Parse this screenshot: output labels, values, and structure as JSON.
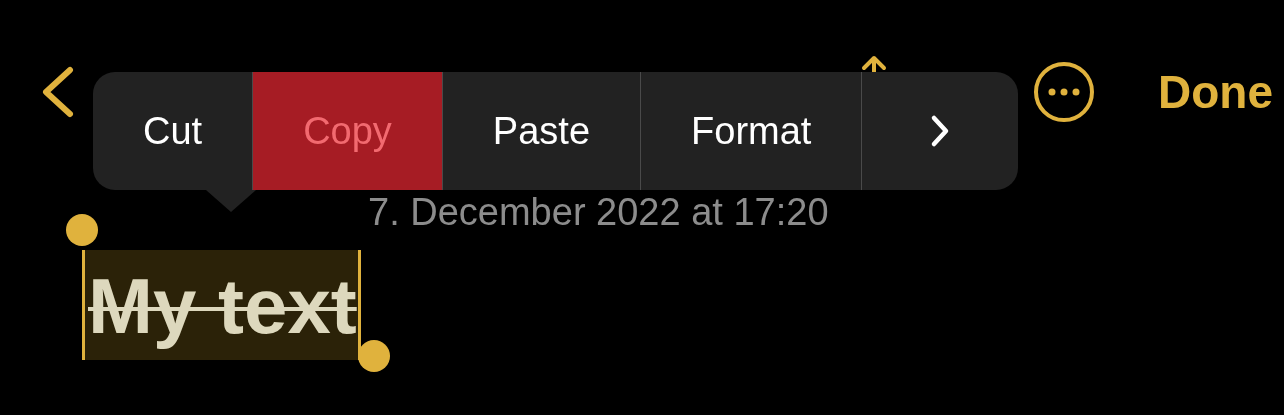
{
  "nav": {
    "done": "Done"
  },
  "note": {
    "date": "7. December 2022 at 17:20",
    "title": {
      "text": "My text",
      "strikethrough": true,
      "selected": true
    }
  },
  "edit_menu": {
    "items": [
      {
        "kind": "action",
        "label": "Cut",
        "selected": false
      },
      {
        "kind": "action",
        "label": "Copy",
        "selected": true
      },
      {
        "kind": "action",
        "label": "Paste",
        "selected": false
      },
      {
        "kind": "action",
        "label": "Format",
        "selected": false
      },
      {
        "kind": "more",
        "selected": false
      }
    ]
  }
}
